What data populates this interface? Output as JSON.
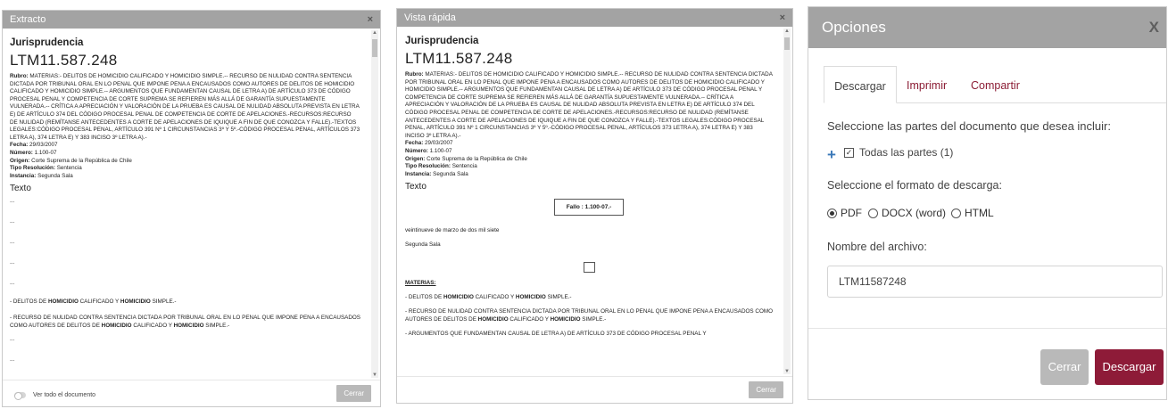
{
  "extracto": {
    "title": "Extracto",
    "close_label": "×",
    "heading": "Jurisprudencia",
    "id": "LTM11.587.248",
    "rubro_label": "Rubro:",
    "rubro_text": "MATERIAS:- DELITOS DE HOMICIDIO CALIFICADO Y HOMICIDIO SIMPLE.-- RECURSO DE NULIDAD CONTRA SENTENCIA DICTADA POR TRIBUNAL ORAL EN LO PENAL QUE IMPONE PENA A ENCAUSADOS COMO AUTORES DE DELITOS DE HOMICIDIO CALIFICADO Y HOMICIDIO SIMPLE.-- ARGUMENTOS QUE FUNDAMENTAN CAUSAL DE LETRA A) DE ARTÍCULO 373 DE CÓDIGO PROCESAL PENAL Y COMPETENCIA DE CORTE SUPREMA SE REFIEREN MÁS ALLÁ DE GARANTÍA SUPUESTAMENTE VULNERADA.-- CRÍTICA A APRECIACIÓN Y VALORACIÓN DE LA PRUEBA ES CAUSAL DE NULIDAD ABSOLUTA PREVISTA EN LETRA E) DE ARTÍCULO 374 DEL CÓDIGO PROCESAL PENAL DE COMPETENCIA DE CORTE DE APELACIONES.-RECURSOS:RECURSO DE NULIDAD (REMÍTANSE ANTECEDENTES A CORTE DE APELACIONES DE IQUIQUE A FIN DE QUE CONOZCA Y FALLE).-TEXTOS LEGALES:CÓDIGO PROCESAL PENAL, ARTÍCULO 391 Nº 1 CIRCUNSTANCIAS 3º Y 5º.-CÓDIGO PROCESAL PENAL, ARTÍCULOS 373 LETRA A), 374 LETRA E) Y 383 INCISO 3º LETRA A).-",
    "fecha_label": "Fecha:",
    "fecha": "29/03/2007",
    "numero_label": "Número:",
    "numero": "1.100-07",
    "origen_label": "Origen:",
    "origen": "Corte Suprema de la República de Chile",
    "tipo_label": "Tipo Resolución:",
    "tipo": "Sentencia",
    "instancia_label": "Instancia:",
    "instancia": "Segunda Sala",
    "texto_label": "Texto",
    "ellipsis": "...",
    "p1_a": "- DELITOS DE ",
    "p1_b": "HOMICIDIO",
    "p1_c": " CALIFICADO Y ",
    "p1_d": "HOMICIDIO",
    "p1_e": " SIMPLE.-",
    "p2_a": "- RECURSO DE NULIDAD CONTRA SENTENCIA DICTADA POR TRIBUNAL ORAL EN LO PENAL QUE IMPONE PENA A ENCAUSADOS COMO AUTORES DE DELITOS DE ",
    "p2_b": "HOMICIDIO",
    "p2_c": " CALIFICADO Y ",
    "p2_d": "HOMICIDIO",
    "p2_e": " SIMPLE.-",
    "toggle_label": "Ver todo el documento",
    "close_button": "Cerrar"
  },
  "vista": {
    "title": "Vista rápida",
    "close_label": "×",
    "heading": "Jurisprudencia",
    "id": "LTM11.587.248",
    "texto_label": "Texto",
    "fallo": "Fallo : 1.100-07.-",
    "date_line": "veintinueve de marzo de dos mil siete",
    "sala_line": "Segunda Sala",
    "materias": "MATERIAS:",
    "m1_a": "- DELITOS DE ",
    "m1_b": "HOMICIDIO",
    "m1_c": " CALIFICADO Y ",
    "m1_d": "HOMICIDIO",
    "m1_e": " SIMPLE.-",
    "m2_a": "- RECURSO DE NULIDAD CONTRA SENTENCIA DICTADA POR TRIBUNAL ORAL EN LO PENAL QUE IMPONE PENA A ENCAUSADOS COMO AUTORES DE DELITOS DE ",
    "m2_b": "HOMICIDIO",
    "m2_c": " CALIFICADO Y ",
    "m2_d": "HOMICIDIO",
    "m2_e": " SIMPLE.-",
    "m3": "- ARGUMENTOS QUE FUNDAMENTAN CAUSAL DE LETRA A) DE ARTÍCULO 373 DE CÓDIGO PROCESAL PENAL Y",
    "close_button": "Cerrar"
  },
  "opciones": {
    "title": "Opciones",
    "close_label": "X",
    "tabs": [
      "Descargar",
      "Imprimir",
      "Compartir"
    ],
    "parts_prompt": "Seleccione las partes del documento que desea incluir:",
    "expand_icon": "+",
    "check_mark": "✓",
    "all_parts": "Todas las partes (1)",
    "format_prompt": "Seleccione el formato de descarga:",
    "formats": [
      "PDF",
      "DOCX (word)",
      "HTML"
    ],
    "selected_format": "PDF",
    "filename_label": "Nombre del archivo:",
    "filename_value": "LTM11587248",
    "cancel_button": "Cerrar",
    "download_button": "Descargar",
    "accent_color": "#8e1b38"
  }
}
